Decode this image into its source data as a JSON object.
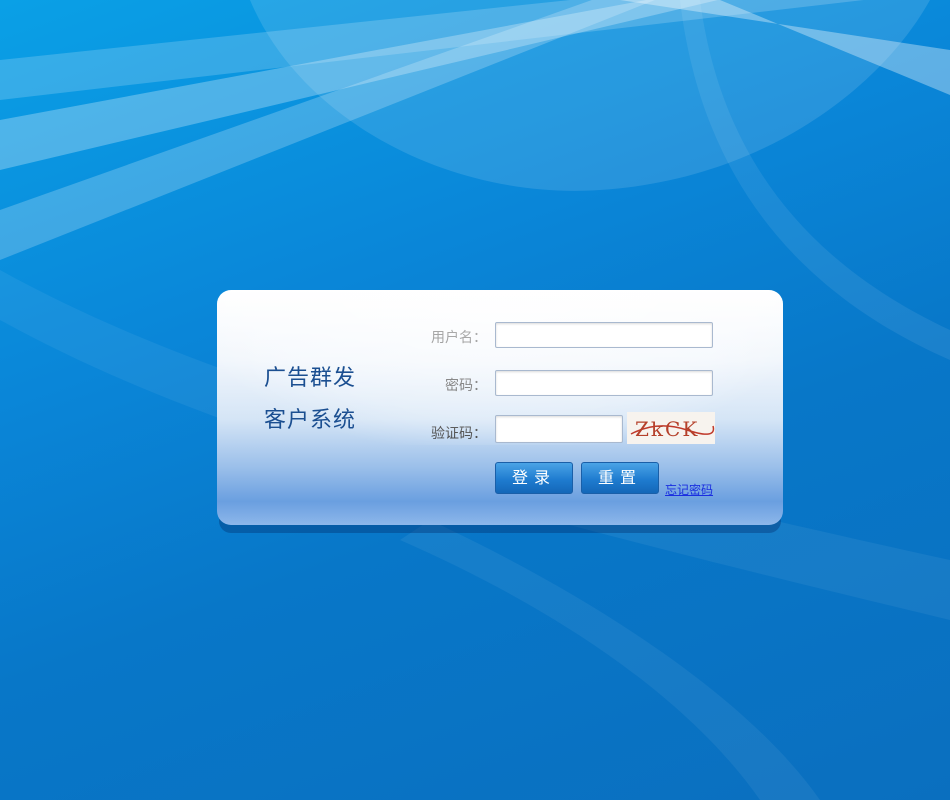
{
  "system": {
    "title_line1": "广告群发",
    "title_line2": "客户系统"
  },
  "form": {
    "username_label": "用户名：",
    "username_value": "",
    "password_label": "密码：",
    "password_value": "",
    "captcha_label": "验证码：",
    "captcha_value": "",
    "captcha_text": "ZkCK"
  },
  "buttons": {
    "login_label": "登录",
    "reset_label": "重置",
    "forgot_label": "忘记密码"
  }
}
